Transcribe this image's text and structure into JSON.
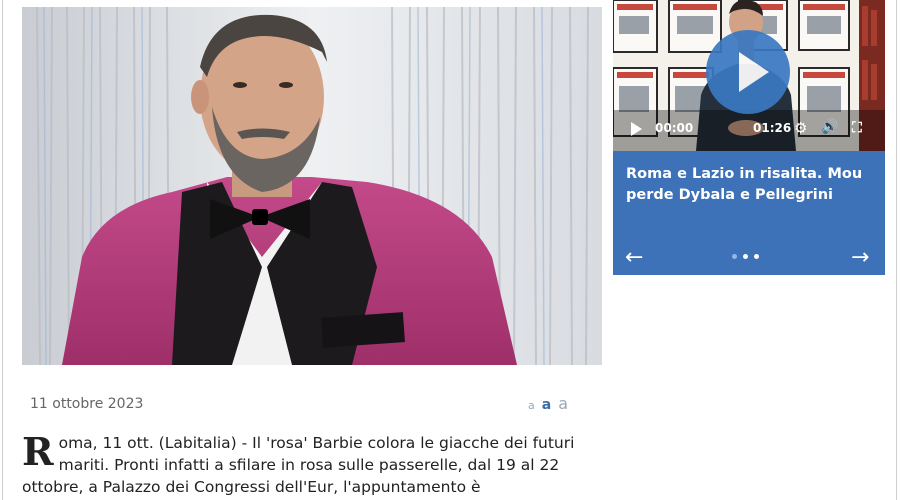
{
  "article": {
    "date": "11 ottobre 2023",
    "dropcap": "R",
    "body": "oma, 11 ott. (Labitalia) - Il 'rosa' Barbie colora le giacche dei futuri mariti. Pronti infatti a sfilare in rosa sulle passerelle, dal 19 al 22 ottobre, a Palazzo dei Congressi dell'Eur, l'appuntamento è"
  },
  "font_size_controls": {
    "small": "a",
    "medium": "a",
    "large": "a"
  },
  "video": {
    "time_current": "00:00",
    "time_total": "01:26",
    "title": "Roma e Lazio in risalita. Mou perde Dybala e Pellegrini",
    "prev_arrow": "←",
    "next_arrow": "→",
    "slides_total": 3,
    "slide_active": 1
  },
  "colors": {
    "widget_blue": "#3e72b8",
    "play_blue": "#3a78c2",
    "jacket_pink": "#b23a7a"
  }
}
